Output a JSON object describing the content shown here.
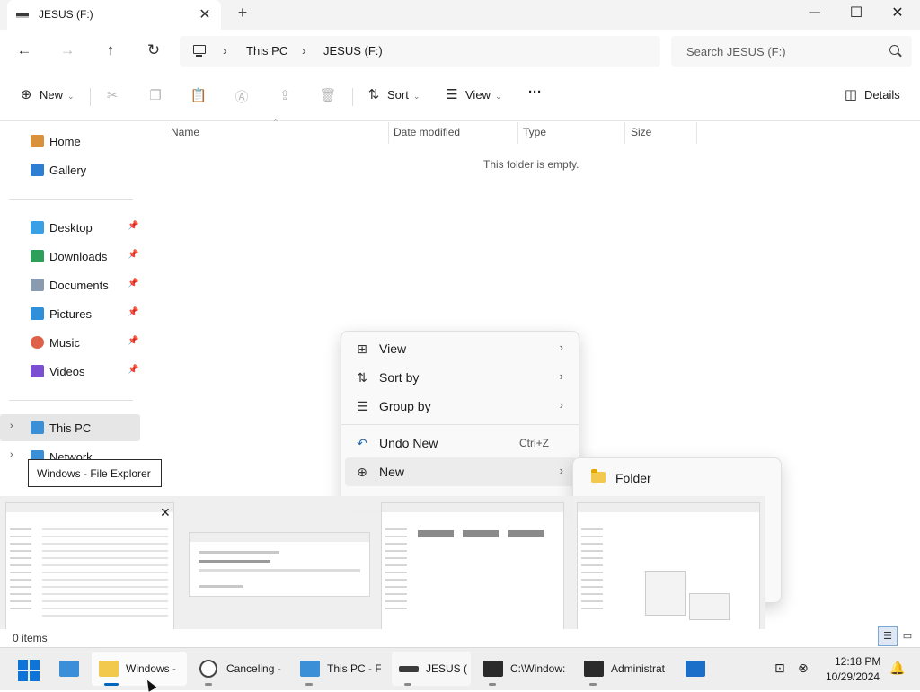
{
  "window": {
    "tab_title": "JESUS (F:)",
    "new_tab_icon": "plus-icon",
    "controls": {
      "minimize": "─",
      "maximize": "☐",
      "close": "✕"
    }
  },
  "address": {
    "breadcrumbs": [
      "This PC",
      "JESUS (F:)"
    ],
    "search_placeholder": "Search JESUS (F:)"
  },
  "commandbar": {
    "new_label": "New",
    "sort_label": "Sort",
    "view_label": "View",
    "more_glyph": "···",
    "details_label": "Details"
  },
  "sidebar": {
    "top_items": [
      {
        "label": "Home",
        "icon": "home-icon",
        "color": "#d9923b"
      },
      {
        "label": "Gallery",
        "icon": "gallery-icon",
        "color": "#2d7dd2"
      }
    ],
    "pinned_items": [
      {
        "label": "Desktop",
        "icon": "desktop-icon",
        "color": "#3aa0e6"
      },
      {
        "label": "Downloads",
        "icon": "download-icon",
        "color": "#2e9e5b"
      },
      {
        "label": "Documents",
        "icon": "documents-icon",
        "color": "#8a9bb0"
      },
      {
        "label": "Pictures",
        "icon": "pictures-icon",
        "color": "#2f8fd8"
      },
      {
        "label": "Music",
        "icon": "music-icon",
        "color": "#e0614a"
      },
      {
        "label": "Videos",
        "icon": "videos-icon",
        "color": "#7a4fd1"
      }
    ],
    "bottom_items": [
      {
        "label": "This PC",
        "icon": "computer-icon",
        "color": "#3a8fd6"
      },
      {
        "label": "Network",
        "icon": "network-icon",
        "color": "#3a8fd6"
      }
    ]
  },
  "filelist": {
    "columns": [
      "Name",
      "Date modified",
      "Type",
      "Size"
    ],
    "empty_message": "This folder is empty."
  },
  "context_menu": {
    "items": [
      {
        "label": "View",
        "icon": "grid-icon",
        "glyph": "⊞",
        "submenu": true
      },
      {
        "label": "Sort by",
        "icon": "sort-icon",
        "glyph": "⇅",
        "submenu": true
      },
      {
        "label": "Group by",
        "icon": "group-icon",
        "glyph": "☰",
        "submenu": true
      },
      {
        "label": "Undo New",
        "icon": "undo-icon",
        "glyph": "↶",
        "shortcut": "Ctrl+Z"
      },
      {
        "label": "New",
        "icon": "new-icon",
        "glyph": "⊕",
        "submenu": true
      }
    ],
    "submenu": {
      "items": [
        {
          "label": "Folder",
          "icon": "folder-icon"
        }
      ]
    }
  },
  "tooltip": {
    "text": "Windows - File Explorer"
  },
  "status": {
    "items_count": "0 items"
  },
  "taskbar": {
    "apps": [
      {
        "label": "",
        "icon": "control-panel-icon",
        "color": "#3b8fd9"
      },
      {
        "label": "Windows - ",
        "icon": "folder-icon",
        "color": "#f2c94c"
      },
      {
        "label": "Canceling - ",
        "icon": "clock-icon",
        "color": "#555555"
      },
      {
        "label": "This PC - Fi",
        "icon": "computer-icon",
        "color": "#3a8fd6"
      },
      {
        "label": "JESUS (F",
        "icon": "drive-icon",
        "color": "#3b3b3b"
      },
      {
        "label": "C:\\Window:",
        "icon": "terminal-icon",
        "color": "#2b2b2b"
      },
      {
        "label": "Administrat",
        "icon": "terminal-icon",
        "color": "#2b2b2b"
      },
      {
        "label": "",
        "icon": "app-icon",
        "color": "#1b6fc9"
      }
    ],
    "clock_time": "12:18 PM",
    "clock_date": "10/29/2024"
  }
}
